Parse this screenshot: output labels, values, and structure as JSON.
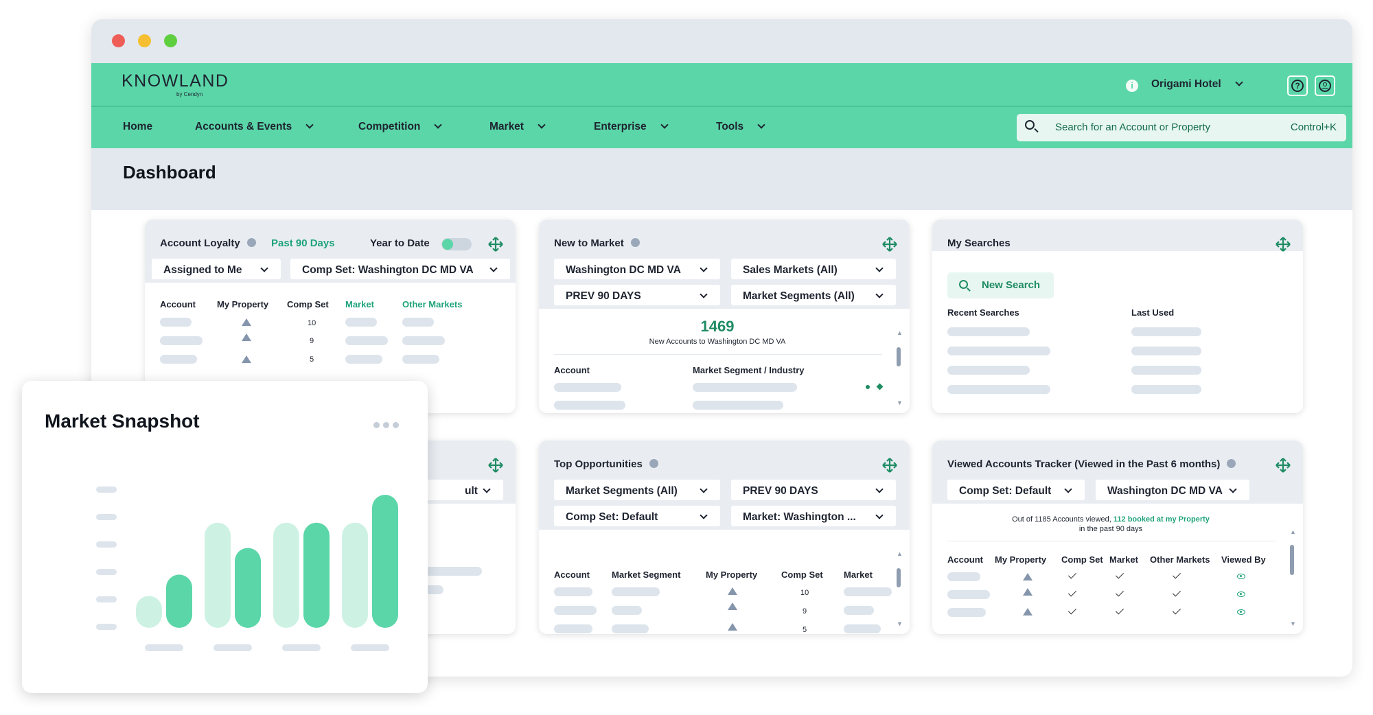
{
  "window": {
    "buttons": [
      "close",
      "minimize",
      "zoom"
    ],
    "colors": {
      "close": "#ee5e57",
      "minimize": "#f6bf31",
      "zoom": "#5fcf3f"
    }
  },
  "header": {
    "logo": "KNOWLAND",
    "logo_sub": "by Cendyn",
    "hotel": "Origami Hotel",
    "icons": [
      "info-icon",
      "help-icon",
      "user-icon"
    ]
  },
  "nav": {
    "items": [
      {
        "label": "Home",
        "dropdown": false
      },
      {
        "label": "Accounts & Events",
        "dropdown": true
      },
      {
        "label": "Competition",
        "dropdown": true
      },
      {
        "label": "Market",
        "dropdown": true
      },
      {
        "label": "Enterprise",
        "dropdown": true
      },
      {
        "label": "Tools",
        "dropdown": true
      }
    ],
    "search_placeholder": "Search for an Account or Property",
    "search_shortcut": "Control+K"
  },
  "page": {
    "title": "Dashboard"
  },
  "account_loyalty": {
    "title": "Account Loyalty",
    "period": "Past 90 Days",
    "toggle_label": "Year to Date",
    "filters": [
      "Assigned to Me",
      "Comp Set: Washington DC MD VA"
    ],
    "columns": [
      "Account",
      "My Property",
      "Comp Set",
      "Market",
      "Other Markets"
    ],
    "comp_set_values": [
      "10",
      "9",
      "5"
    ]
  },
  "new_to_market": {
    "title": "New to Market",
    "filters": [
      "Washington DC MD VA",
      "Sales Markets (All)",
      "PREV 90 DAYS",
      "Market Segments (All)"
    ],
    "count": "1469",
    "count_label": "New Accounts to Washington DC MD VA",
    "columns": [
      "Account",
      "Market Segment / Industry"
    ]
  },
  "my_searches": {
    "title": "My Searches",
    "new_search": "New Search",
    "columns": [
      "Recent Searches",
      "Last Used"
    ]
  },
  "hidden_card": {
    "filter": "ult"
  },
  "top_opportunities": {
    "title": "Top Opportunities",
    "filters": [
      "Market Segments (All)",
      "PREV 90 DAYS",
      "Comp Set: Default",
      "Market: Washington ..."
    ],
    "columns": [
      "Account",
      "Market Segment",
      "My Property",
      "Comp Set",
      "Market"
    ],
    "comp_set_values": [
      "10",
      "9",
      "5"
    ]
  },
  "viewed_accounts": {
    "title": "Viewed Accounts Tracker (Viewed in the Past 6 months)",
    "filters": [
      "Comp Set: Default",
      "Washington DC MD VA"
    ],
    "summary_pre": "Out of 1185 Accounts viewed, ",
    "summary_highlight": "112 booked at my Property",
    "summary_post": "in the past 90 days",
    "columns": [
      "Account",
      "My Property",
      "Comp Set",
      "Market",
      "Other Markets",
      "Viewed By"
    ]
  },
  "market_snapshot": {
    "title": "Market Snapshot",
    "menu_icon": "more-dots-icon",
    "chart_data": {
      "type": "bar",
      "categories": [
        "",
        "",
        "",
        ""
      ],
      "series": [
        {
          "values": [
            0.24,
            0.79,
            0.79,
            0.79
          ],
          "color": "#cdf2e4"
        },
        {
          "values": [
            0.4,
            0.6,
            0.79,
            1.0
          ],
          "color": "#5bd6a8"
        }
      ],
      "ylim": [
        0,
        1
      ]
    }
  }
}
